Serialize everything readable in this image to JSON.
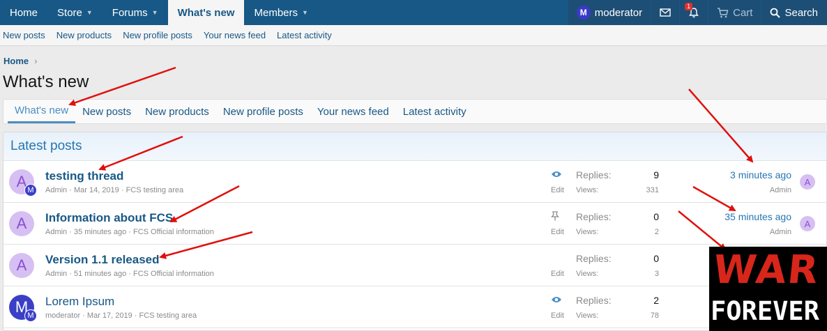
{
  "topnav": {
    "tabs": [
      {
        "label": "Home",
        "caret": false
      },
      {
        "label": "Store",
        "caret": true
      },
      {
        "label": "Forums",
        "caret": true
      },
      {
        "label": "What's new",
        "caret": false,
        "active": true
      },
      {
        "label": "Members",
        "caret": true
      }
    ],
    "user": {
      "initial": "M",
      "name": "moderator"
    },
    "alerts_count": "1",
    "cart_label": "Cart",
    "search_label": "Search"
  },
  "subnav": [
    "New posts",
    "New products",
    "New profile posts",
    "Your news feed",
    "Latest activity"
  ],
  "breadcrumb": {
    "home": "Home",
    "sep": "›"
  },
  "page_title": "What's new",
  "tabs": [
    "What's new",
    "New posts",
    "New products",
    "New profile posts",
    "Your news feed",
    "Latest activity"
  ],
  "block_title": "Latest posts",
  "threads": [
    {
      "avatar": "A",
      "mini_avatar": "M",
      "title": "testing thread",
      "bold": true,
      "author": "Admin",
      "date": "Mar 14, 2019",
      "forum": "FCS testing area",
      "icon": "eye-icon",
      "edit": "Edit",
      "replies_label": "Replies:",
      "replies": "9",
      "views_label": "Views:",
      "views": "331",
      "last_time": "3 minutes ago",
      "last_user": "Admin",
      "last_avatar": "A"
    },
    {
      "avatar": "A",
      "mini_avatar": "",
      "title": "Information about FCS",
      "bold": true,
      "author": "Admin",
      "date": "35 minutes ago",
      "forum": "FCS Official information",
      "icon": "thumbtack-icon",
      "edit": "Edit",
      "replies_label": "Replies:",
      "replies": "0",
      "views_label": "Views:",
      "views": "2",
      "last_time": "35 minutes ago",
      "last_user": "Admin",
      "last_avatar": "A"
    },
    {
      "avatar": "A",
      "mini_avatar": "",
      "title": "Version 1.1 released",
      "bold": true,
      "author": "Admin",
      "date": "51 minutes ago",
      "forum": "FCS Official information",
      "icon": "",
      "edit": "Edit",
      "replies_label": "Replies:",
      "replies": "0",
      "views_label": "Views:",
      "views": "3",
      "last_time": "",
      "last_user": "",
      "last_avatar": ""
    },
    {
      "avatar": "M",
      "mini_avatar": "M",
      "title": "Lorem Ipsum",
      "bold": false,
      "author": "moderator",
      "date": "Mar 17, 2019",
      "forum": "FCS testing area",
      "icon": "eye-icon",
      "edit": "Edit",
      "replies_label": "Replies:",
      "replies": "2",
      "views_label": "Views:",
      "views": "78",
      "last_time": "",
      "last_user": "",
      "last_avatar": ""
    }
  ],
  "meta_sep": " · ",
  "logo": {
    "line1": "WAR",
    "line2": "FOREVER"
  },
  "colors": {
    "nav": "#185886",
    "accent": "#4a8dc4",
    "arrow": "#e0100d"
  }
}
